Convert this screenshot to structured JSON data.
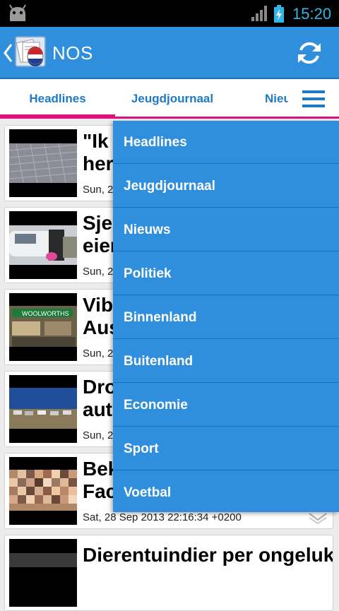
{
  "status_bar": {
    "time": "15:20",
    "icons": [
      "android-icon",
      "signal-icon",
      "battery-charging-icon"
    ]
  },
  "action_bar": {
    "title": "NOS",
    "icons": [
      "back-icon",
      "app-logo-icon",
      "refresh-icon"
    ],
    "accent_color": "#2f8fdc"
  },
  "tabs": {
    "items": [
      {
        "label": "Headlines",
        "selected": true
      },
      {
        "label": "Jeugdjournaal",
        "selected": false
      },
      {
        "label": "Nieu",
        "selected": false
      }
    ],
    "menu_icon": "menu-icon",
    "indicator_color": "#e0107f"
  },
  "feed": {
    "items": [
      {
        "headline": "\"Ik h\nherl",
        "date": "Sun, 2"
      },
      {
        "headline": "Sjei\neien",
        "date": "Sun, 2"
      },
      {
        "headline": "Vibr\nAus",
        "date": "Sun, 2"
      },
      {
        "headline": "Dro\nauto",
        "date": "Sun, 2"
      },
      {
        "headline": "Bek\nFace",
        "date": "Sat, 28 Sep 2013 22:16:34 +0200"
      },
      {
        "headline": "Dierentuindier per ongeluk",
        "date": ""
      }
    ]
  },
  "dropdown": {
    "items": [
      "Headlines",
      "Jeugdjournaal",
      "Nieuws",
      "Politiek",
      "Binnenland",
      "Buitenland",
      "Economie",
      "Sport",
      "Voetbal"
    ]
  }
}
